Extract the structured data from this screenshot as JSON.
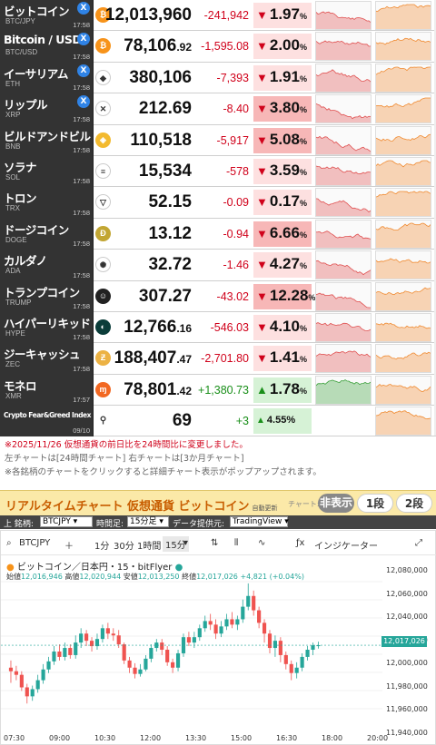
{
  "rates": [
    {
      "name": "ビットコイン",
      "ticker": "BTC/JPY",
      "time": "17:58",
      "x": true,
      "coin": "bitcoin",
      "coin_color": "#f7931a",
      "coin_glyph": "₿",
      "price": "12,013,960",
      "price_dec": "",
      "change": "-241,942",
      "dir": "down",
      "pct": "1.97",
      "pct_unit": "%",
      "big": false
    },
    {
      "name": "Bitcoin / USD",
      "ticker": "BTC/USD",
      "time": "17:58",
      "x": true,
      "coin": "bitcoin",
      "coin_color": "#f7931a",
      "coin_glyph": "₿",
      "price": "78,106",
      "price_dec": ".92",
      "change": "-1,595.08",
      "dir": "down",
      "pct": "2.00",
      "pct_unit": "%",
      "big": false
    },
    {
      "name": "イーサリアム",
      "ticker": "ETH",
      "time": "17:58",
      "x": true,
      "coin": "ethereum",
      "coin_color": "#ffffff",
      "coin_glyph": "◆",
      "price": "380,106",
      "price_dec": "",
      "change": "-7,393",
      "dir": "down",
      "pct": "1.91",
      "pct_unit": "%",
      "big": false
    },
    {
      "name": "リップル",
      "ticker": "XRP",
      "time": "17:58",
      "x": true,
      "coin": "xrp",
      "coin_color": "#ffffff",
      "coin_glyph": "✕",
      "price": "212.69",
      "price_dec": "",
      "change": "-8.40",
      "dir": "down",
      "pct": "3.80",
      "pct_unit": "%",
      "big": true
    },
    {
      "name": "ビルドアンドビルド",
      "ticker": "BNB",
      "time": "17:58",
      "x": false,
      "coin": "bnb",
      "coin_color": "#f3ba2f",
      "coin_glyph": "◈",
      "price": "110,518",
      "price_dec": "",
      "change": "-5,917",
      "dir": "down",
      "pct": "5.08",
      "pct_unit": "%",
      "big": true
    },
    {
      "name": "ソラナ",
      "ticker": "SOL",
      "time": "17:58",
      "x": false,
      "coin": "solana",
      "coin_color": "#ffffff",
      "coin_glyph": "≡",
      "price": "15,534",
      "price_dec": "",
      "change": "-578",
      "dir": "down",
      "pct": "3.59",
      "pct_unit": "%",
      "big": false
    },
    {
      "name": "トロン",
      "ticker": "TRX",
      "time": "17:58",
      "x": false,
      "coin": "tron",
      "coin_color": "#ffffff",
      "coin_glyph": "▽",
      "price": "52.15",
      "price_dec": "",
      "change": "-0.09",
      "dir": "down",
      "pct": "0.17",
      "pct_unit": "%",
      "big": false
    },
    {
      "name": "ドージコイン",
      "ticker": "DOGE",
      "time": "17:58",
      "x": false,
      "coin": "dogecoin",
      "coin_color": "#c2a633",
      "coin_glyph": "Ð",
      "price": "13.12",
      "price_dec": "",
      "change": "-0.94",
      "dir": "down",
      "pct": "6.66",
      "pct_unit": "%",
      "big": true
    },
    {
      "name": "カルダノ",
      "ticker": "ADA",
      "time": "17:58",
      "x": false,
      "coin": "cardano",
      "coin_color": "#ffffff",
      "coin_glyph": "✺",
      "price": "32.72",
      "price_dec": "",
      "change": "-1.46",
      "dir": "down",
      "pct": "4.27",
      "pct_unit": "%",
      "big": false
    },
    {
      "name": "トランプコイン",
      "ticker": "TRUMP",
      "time": "17:58",
      "x": false,
      "coin": "trump",
      "coin_color": "#222222",
      "coin_glyph": "☺",
      "price": "307.27",
      "price_dec": "",
      "change": "-43.02",
      "dir": "down",
      "pct": "12.28",
      "pct_unit": "%",
      "big": true
    },
    {
      "name": "ハイパーリキッド",
      "ticker": "HYPE",
      "time": "17:58",
      "x": false,
      "coin": "hyperliquid",
      "coin_color": "#0b3d3a",
      "coin_glyph": "◐",
      "price": "12,766",
      "price_dec": ".16",
      "change": "-546.03",
      "dir": "down",
      "pct": "4.10",
      "pct_unit": "%",
      "big": false
    },
    {
      "name": "ジーキャッシュ",
      "ticker": "ZEC",
      "time": "17:58",
      "x": false,
      "coin": "zcash",
      "coin_color": "#ecb244",
      "coin_glyph": "Ƶ",
      "price": "188,407",
      "price_dec": ".47",
      "change": "-2,701.80",
      "dir": "down",
      "pct": "1.41",
      "pct_unit": "%",
      "big": false
    },
    {
      "name": "モネロ",
      "ticker": "XMR",
      "time": "17:57",
      "x": false,
      "coin": "monero",
      "coin_color": "#f26822",
      "coin_glyph": "ɱ",
      "price": "78,801",
      "price_dec": ".42",
      "change": "+1,380.73",
      "dir": "up",
      "pct": "1.78",
      "pct_unit": "%",
      "big": false
    }
  ],
  "fear_greed": {
    "name": "Crypto Fear&Greed Index",
    "date": "09/10",
    "value": "69",
    "change": "+3",
    "pct": "4.55",
    "pct_unit": "%"
  },
  "notes": {
    "line1": "※2025/11/26 仮想通貨の前日比を24時間比に変更しました。",
    "line2": "左チャートは[24時間チャート] 右チャートは[3か月チャート]",
    "line3": "※各銘柄のチャートをクリックすると詳細チャート表示がポップアップされます。"
  },
  "realtime": {
    "title": "リアルタイムチャート 仮想通貨 ビットコイン",
    "auto": "自動更新",
    "chart_label": "チャート:",
    "hide": "非表示",
    "one": "1段",
    "two": "2段"
  },
  "controls": {
    "symbol_label": "上 銘柄:",
    "symbol": "BTCJPY",
    "period_label": "時間足:",
    "period": "15分足",
    "provider_label": "データ提供元:",
    "provider": "TradingView"
  },
  "toolbar": {
    "symbol": "BTCJPY",
    "t1": "1分",
    "t2": "30分",
    "t3": "1時間",
    "t4": "15分",
    "indicators": "インジケーター"
  },
  "ohlc": {
    "title": "ビットコイン／日本円・15・bitFlyer",
    "open_label": "始値",
    "open": "12,016,946",
    "high_label": "高値",
    "high": "12,020,944",
    "low_label": "安値",
    "low": "12,013,250",
    "close_label": "終値",
    "close": "12,017,026",
    "delta": "+4,821 (+0.04%)"
  },
  "chart_data": {
    "type": "candlestick",
    "x_ticks": [
      "07:30",
      "09:00",
      "10:30",
      "12:00",
      "13:30",
      "15:00",
      "16:30",
      "18:00",
      "20:00"
    ],
    "y_ticks": [
      "12,080,000",
      "12,060,000",
      "12,040,000",
      "12,020,000",
      "12,000,000",
      "11,980,000",
      "11,960,000",
      "11,940,000"
    ],
    "ylim": [
      11930000,
      12092000
    ],
    "last_price": "12,017,026",
    "candles": [
      [
        11992000,
        11988000,
        12000000,
        11975000
      ],
      [
        11988000,
        11984000,
        11994000,
        11978000
      ],
      [
        11984000,
        11970000,
        11988000,
        11966000
      ],
      [
        11970000,
        11960000,
        11974000,
        11952000
      ],
      [
        11960000,
        11968000,
        11972000,
        11955000
      ],
      [
        11968000,
        11978000,
        11984000,
        11964000
      ],
      [
        11978000,
        11990000,
        11996000,
        11974000
      ],
      [
        11990000,
        11999000,
        12004000,
        11986000
      ],
      [
        11999000,
        12010000,
        12016000,
        11995000
      ],
      [
        12010000,
        12004000,
        12018000,
        12000000
      ],
      [
        12004000,
        12014000,
        12020000,
        12000000
      ],
      [
        12014000,
        12006000,
        12018000,
        12002000
      ],
      [
        12006000,
        12020000,
        12028000,
        12002000
      ],
      [
        12020000,
        12030000,
        12036000,
        12014000
      ],
      [
        12030000,
        12022000,
        12034000,
        12016000
      ],
      [
        12022000,
        12016000,
        12026000,
        12010000
      ],
      [
        12016000,
        12024000,
        12030000,
        12012000
      ],
      [
        12024000,
        12036000,
        12040000,
        12020000
      ],
      [
        12036000,
        12030000,
        12042000,
        12024000
      ],
      [
        12030000,
        12028000,
        12036000,
        12022000
      ],
      [
        12028000,
        12018000,
        12034000,
        12014000
      ],
      [
        12018000,
        12000000,
        12020000,
        11996000
      ],
      [
        12000000,
        11992000,
        12004000,
        11986000
      ],
      [
        11992000,
        11985000,
        11997000,
        11980000
      ],
      [
        11985000,
        11990000,
        11996000,
        11982000
      ],
      [
        11990000,
        12002000,
        12006000,
        11988000
      ],
      [
        12002000,
        12014000,
        12018000,
        11998000
      ],
      [
        12014000,
        12020000,
        12024000,
        12010000
      ],
      [
        12020000,
        12012000,
        12024000,
        12006000
      ],
      [
        12012000,
        11998000,
        12016000,
        11994000
      ],
      [
        11998000,
        11992000,
        12002000,
        11986000
      ],
      [
        11992000,
        12008000,
        12012000,
        11988000
      ],
      [
        12008000,
        12026000,
        12030000,
        12004000
      ],
      [
        12026000,
        12020000,
        12032000,
        12016000
      ],
      [
        12020000,
        12026000,
        12032000,
        12014000
      ],
      [
        12026000,
        12036000,
        12040000,
        12022000
      ],
      [
        12036000,
        12044000,
        12050000,
        12032000
      ],
      [
        12044000,
        12040000,
        12052000,
        12034000
      ],
      [
        12040000,
        12030000,
        12046000,
        12024000
      ],
      [
        12030000,
        12038000,
        12044000,
        12026000
      ],
      [
        12038000,
        12046000,
        12052000,
        12034000
      ],
      [
        12046000,
        12040000,
        12054000,
        12036000
      ],
      [
        12040000,
        12046000,
        12050000,
        12034000
      ],
      [
        12046000,
        12060000,
        12068000,
        12042000
      ],
      [
        12060000,
        12072000,
        12086000,
        12056000
      ],
      [
        12072000,
        12056000,
        12078000,
        12050000
      ],
      [
        12056000,
        12042000,
        12060000,
        12036000
      ],
      [
        12042000,
        12030000,
        12046000,
        12020000
      ],
      [
        12030000,
        12014000,
        12034000,
        12008000
      ],
      [
        12014000,
        12022000,
        12028000,
        12004000
      ],
      [
        12022000,
        12006000,
        12026000,
        11998000
      ],
      [
        12006000,
        11996000,
        12010000,
        11990000
      ],
      [
        11996000,
        11986000,
        12000000,
        11978000
      ],
      [
        11986000,
        11992000,
        11998000,
        11980000
      ],
      [
        11992000,
        12004000,
        12008000,
        11988000
      ],
      [
        12004000,
        12012000,
        12016000,
        12000000
      ],
      [
        12012000,
        12016946,
        12020000,
        12006000
      ],
      [
        12016946,
        12017026,
        12020944,
        12013250
      ]
    ]
  }
}
